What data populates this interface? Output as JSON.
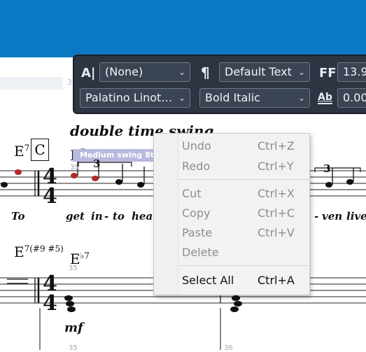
{
  "toolbar": {
    "style_icon": "A|",
    "style_value": "(None)",
    "paragraph_icon": "¶",
    "text_style_value": "Default Text",
    "font_size_icon": "FF",
    "font_size_value": "13.9",
    "font_value": "Palatino Linot…",
    "font_style_value": "Bold Italic",
    "spacing_icon": "Ab",
    "spacing_value": "0.00"
  },
  "score": {
    "ghost_measure": "35",
    "tempo_text": "double time swing",
    "chord1": "E",
    "chord1_sup": "7",
    "chord_box": "C",
    "chord2": "E",
    "chord2_sup": "7",
    "highlight_text": "Medium swing 8th",
    "measure_a": "35",
    "lyrics": [
      "To",
      "get",
      "in",
      "-",
      "to",
      "hea",
      "-",
      "ven",
      "live"
    ],
    "chord3": "E",
    "chord3_sup": "7(#9 #5)",
    "chord4": "E",
    "chord4_sup": "♭7",
    "measure_b": "35",
    "measure_c": "35",
    "measure_d": "36",
    "dynamic": "mf",
    "triplet": "3"
  },
  "context_menu": {
    "items": [
      {
        "label": "Undo",
        "shortcut": "Ctrl+Z",
        "enabled": false
      },
      {
        "label": "Redo",
        "shortcut": "Ctrl+Y",
        "enabled": false
      },
      {
        "label": "Cut",
        "shortcut": "Ctrl+X",
        "enabled": false
      },
      {
        "label": "Copy",
        "shortcut": "Ctrl+C",
        "enabled": false
      },
      {
        "label": "Paste",
        "shortcut": "Ctrl+V",
        "enabled": false
      },
      {
        "label": "Delete",
        "shortcut": "",
        "enabled": false
      },
      {
        "label": "Select All",
        "shortcut": "Ctrl+A",
        "enabled": true
      }
    ]
  },
  "colors": {
    "header_blue": "#0a78c2",
    "toolbar_bg": "#2d3542",
    "note_red": "#b02a2a",
    "selection_highlight": "#b8b9de"
  }
}
